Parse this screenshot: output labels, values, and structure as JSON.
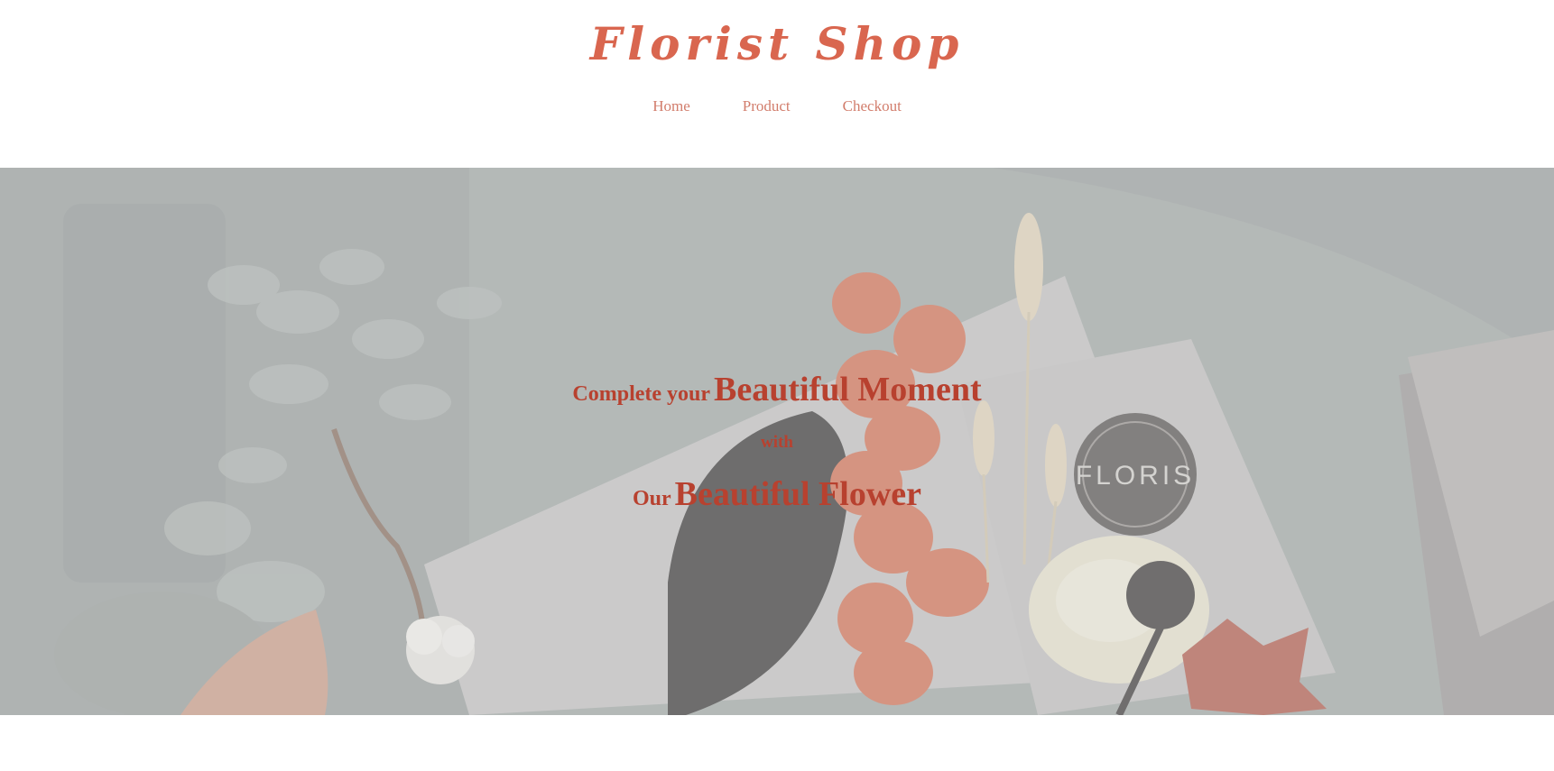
{
  "header": {
    "brand": "Florist Shop",
    "nav": [
      {
        "label": "Home"
      },
      {
        "label": "Product"
      },
      {
        "label": "Checkout"
      }
    ]
  },
  "hero": {
    "line1_small": "Complete your",
    "line1_big": "Beautiful Moment",
    "line2": "with",
    "line3_small": "Our",
    "line3_big": "Beautiful Flower",
    "badge_text": "FLORIS"
  },
  "colors": {
    "brand": "#d9664f",
    "nav": "#d27d6c",
    "hero_text": "#b8412f"
  }
}
